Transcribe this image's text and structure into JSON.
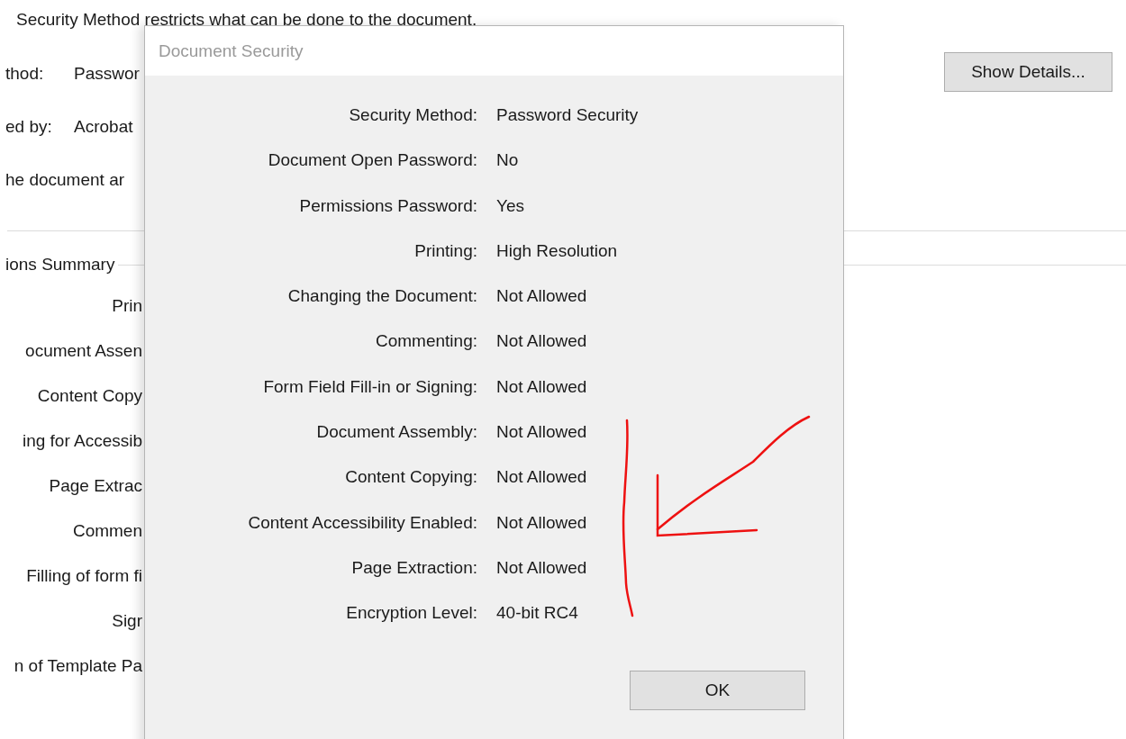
{
  "background_window": {
    "intro": "Security Method restricts what can be done to the document.",
    "fields": [
      {
        "label": "thod:",
        "value": "Passwor"
      },
      {
        "label": "ed by:",
        "value": "Acrobat"
      }
    ],
    "note": "he document ar",
    "show_details_button": "Show Details...",
    "summary_title": "ions Summary",
    "summary_labels": [
      "Prin",
      "ocument Assen",
      "Content Copy",
      "ing for Accessib",
      "Page Extrac",
      "Commen",
      "Filling of form fi",
      "Sigr",
      "n of Template Pa"
    ]
  },
  "dialog": {
    "title": "Document Security",
    "rows": [
      {
        "label": "Security Method:",
        "value": "Password Security"
      },
      {
        "label": "Document Open Password:",
        "value": "No"
      },
      {
        "label": "Permissions Password:",
        "value": "Yes"
      },
      {
        "label": "Printing:",
        "value": "High Resolution"
      },
      {
        "label": "Changing the Document:",
        "value": "Not Allowed"
      },
      {
        "label": "Commenting:",
        "value": "Not Allowed"
      },
      {
        "label": "Form Field Fill-in or Signing:",
        "value": "Not Allowed"
      },
      {
        "label": "Document Assembly:",
        "value": "Not Allowed"
      },
      {
        "label": "Content Copying:",
        "value": "Not Allowed"
      },
      {
        "label": "Content Accessibility Enabled:",
        "value": "Not Allowed"
      },
      {
        "label": "Page Extraction:",
        "value": "Not Allowed"
      },
      {
        "label": "Encryption Level:",
        "value": "40-bit RC4"
      }
    ],
    "ok_button": "OK"
  }
}
